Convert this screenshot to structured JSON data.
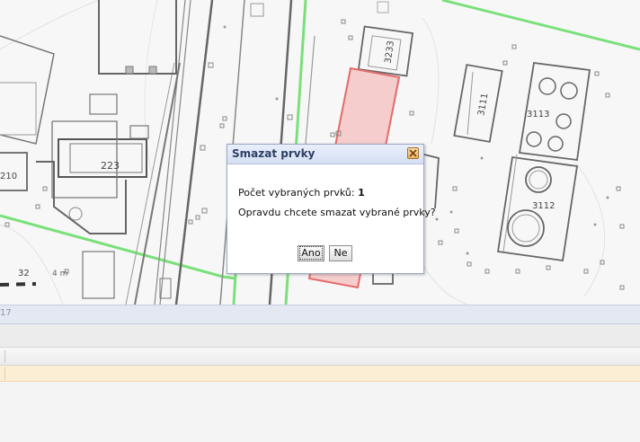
{
  "map": {
    "labels": {
      "b3233": "3233",
      "b3111": "3111",
      "b3113": "3113",
      "b3112": "3112",
      "b223": "223",
      "b210": "210",
      "b32": "32",
      "b4m": "4 m"
    },
    "colors": {
      "selection_fill": "#f5c5c5",
      "selection_stroke": "#e46a6a",
      "boundary_green": "#7ae07a",
      "building_line": "#777777"
    }
  },
  "dialog": {
    "title": "Smazat prvky",
    "count_label": "Počet vybraných prvků:",
    "count_value": "1",
    "question": "Opravdu chcete smazat vybrané prvky?",
    "yes_button": "Ano",
    "no_button": "Ne",
    "close_icon": "close-icon"
  },
  "panel": {
    "edge_text": "17"
  }
}
